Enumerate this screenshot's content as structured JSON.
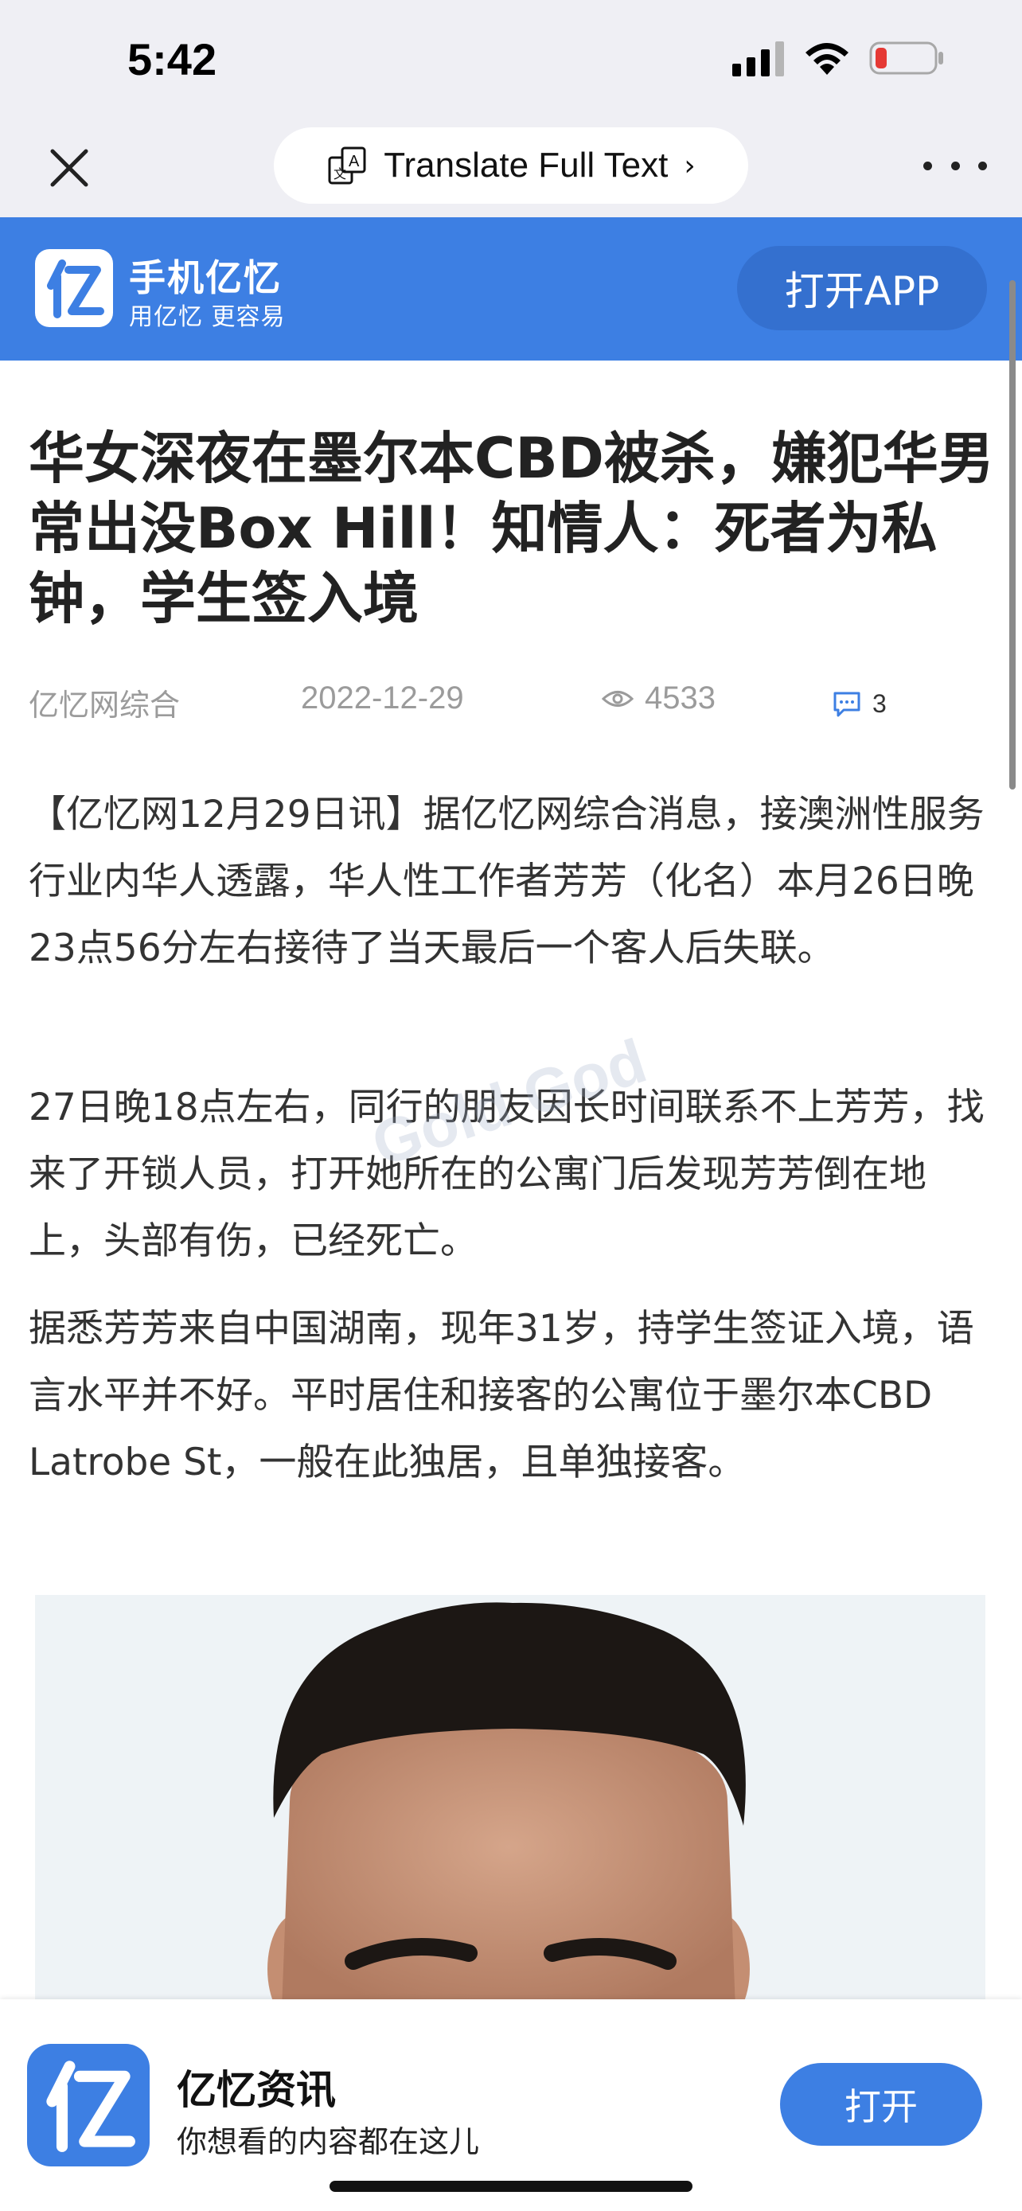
{
  "status_bar": {
    "time": "5:42",
    "icons": [
      "cellular-signal-icon",
      "wifi-icon",
      "battery-low-icon"
    ],
    "battery_color": "#e53935"
  },
  "browser": {
    "translate_label": "Translate Full Text",
    "translate_chevron": "›",
    "icons": [
      "close-icon",
      "translate-icon",
      "more-icon"
    ]
  },
  "app_banner": {
    "background": "#3d7fe3",
    "app_title": "手机亿忆",
    "app_tagline": "用亿忆 更容易",
    "open_label": "打开APP"
  },
  "article": {
    "title": "华女深夜在墨尔本CBD被杀，嫌犯华男常出没Box Hill！知情人：死者为私钟，学生签入境",
    "source": "亿忆网综合",
    "date": "2022-12-29",
    "views": "4533",
    "comments": "3",
    "paragraphs": [
      "【亿忆网12月29日讯】据亿忆网综合消息，接澳洲性服务行业内华人透露，华人性工作者芳芳（化名）本月26日晚23点56分左右接待了当天最后一个客人后失联。",
      "27日晚18点左右，同行的朋友因长时间联系不上芳芳，找来了开锁人员，打开她所在的公寓门后发现芳芳倒在地上，头部有伤，已经死亡。",
      "据悉芳芳来自中国湖南，现年31岁，持学生签证入境，语言水平并不好。平时居住和接客的公寓位于墨尔本CBD Latrobe St，一般在此独居，且单独接客。"
    ],
    "watermark": "Gold God"
  },
  "bottom_bar": {
    "app_name": "亿忆资讯",
    "app_desc": "你想看的内容都在这儿",
    "open_label": "打开"
  }
}
